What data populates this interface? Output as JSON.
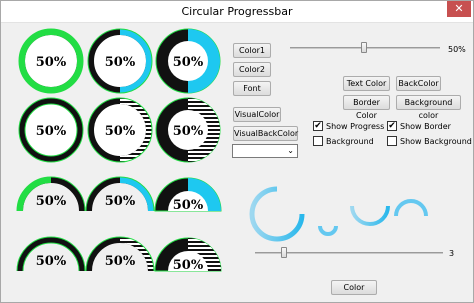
{
  "window": {
    "title": "Circular Progressbar",
    "close_glyph": "✕"
  },
  "progress": {
    "label": "50%",
    "value_fraction": 0.5
  },
  "buttons": {
    "color1": "Color1",
    "color2": "Color2",
    "font": "Font",
    "visual_color": "VisualColor",
    "visual_back_color": "VisualBackColor",
    "text_color": "Text Color",
    "back_color": "BackColor",
    "border_color": "Border Color",
    "background_color": "Background color",
    "color": "Color"
  },
  "slider_top": {
    "value_label": "50%",
    "value": 50
  },
  "slider_bottom": {
    "value_label": "3",
    "value": 3
  },
  "checkboxes": {
    "show_progress": {
      "label": "Show Progress",
      "checked": true
    },
    "show_border": {
      "label": "Show Border",
      "checked": true
    },
    "background": {
      "label": "Background",
      "checked": false
    },
    "show_background": {
      "label": "Show Background",
      "checked": false
    }
  },
  "check_glyph": "✔",
  "dropdown": {
    "selected": "",
    "arrow": "⌄"
  },
  "colors": {
    "accent": "#1ec8f0",
    "border_green": "#22dd44",
    "ring_black": "#0a0a0a",
    "light_blue": "#64c8f0"
  }
}
